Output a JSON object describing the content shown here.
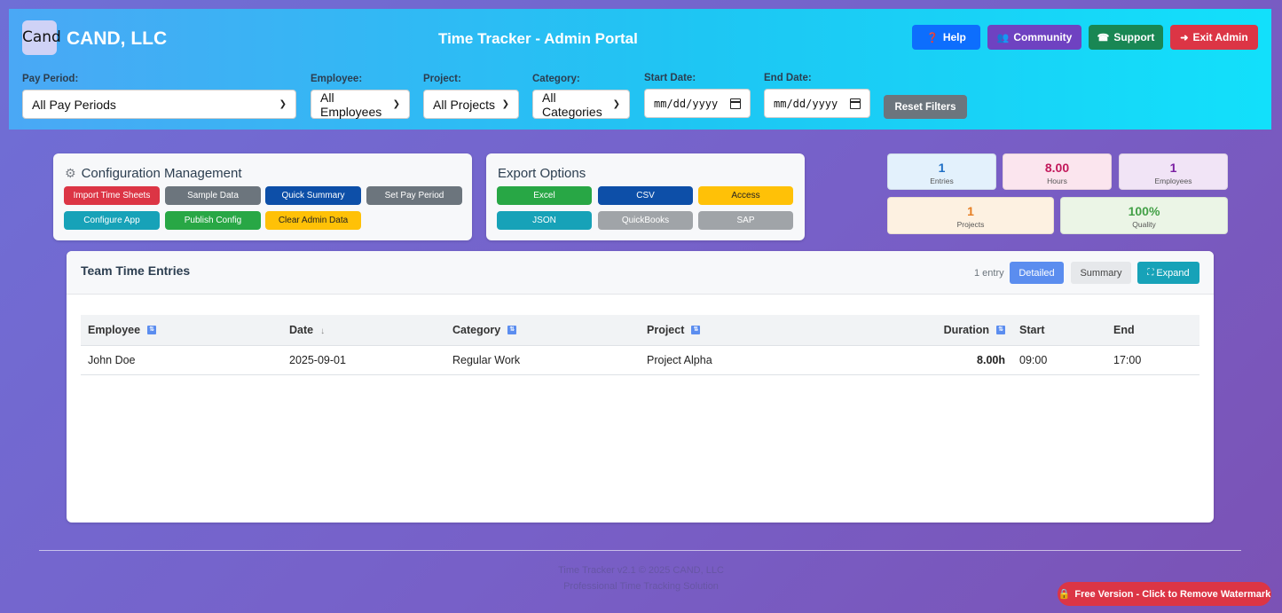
{
  "header": {
    "logo_text": "Cand",
    "company": "CAND, LLC",
    "title": "Time Tracker - Admin Portal",
    "buttons": {
      "help": "Help",
      "community": "Community",
      "support": "Support",
      "exit": "Exit Admin"
    }
  },
  "filters": {
    "pay_period": {
      "label": "Pay Period:",
      "value": "All Pay Periods"
    },
    "employee": {
      "label": "Employee:",
      "value": "All Employees"
    },
    "project": {
      "label": "Project:",
      "value": "All Projects"
    },
    "category": {
      "label": "Category:",
      "value": "All Categories"
    },
    "start_date": {
      "label": "Start Date:",
      "placeholder": "mm/dd/yyyy"
    },
    "end_date": {
      "label": "End Date:",
      "placeholder": "mm/dd/yyyy"
    },
    "reset": "Reset Filters"
  },
  "config": {
    "title": "Configuration Management",
    "buttons": [
      "Import Time Sheets",
      "Sample Data",
      "Quick Summary",
      "Set Pay Period",
      "Configure App",
      "Publish Config",
      "Clear Admin Data"
    ]
  },
  "export": {
    "title": "Export Options",
    "buttons": [
      "Excel",
      "CSV",
      "Access",
      "JSON",
      "QuickBooks",
      "SAP"
    ]
  },
  "stats": {
    "entries": {
      "value": "1",
      "label": "Entries",
      "color": "#1f6fc5"
    },
    "hours": {
      "value": "8.00",
      "label": "Hours",
      "color": "#c2185b"
    },
    "employees": {
      "value": "1",
      "label": "Employees",
      "color": "#7b1fa2"
    },
    "projects": {
      "value": "1",
      "label": "Projects",
      "color": "#e67e22"
    },
    "quality": {
      "value": "100%",
      "label": "Quality",
      "color": "#43a047"
    }
  },
  "table": {
    "title": "Team Time Entries",
    "count": "1 entry",
    "views": {
      "detailed": "Detailed",
      "summary": "Summary",
      "expand": "Expand"
    },
    "columns": [
      "Employee",
      "Date",
      "Category",
      "Project",
      "Duration",
      "Start",
      "End"
    ],
    "rows": [
      {
        "employee": "John Doe",
        "date": "2025-09-01",
        "category": "Regular Work",
        "project": "Project Alpha",
        "duration": "8.00h",
        "start": "09:00",
        "end": "17:00"
      }
    ]
  },
  "footer": {
    "line1": "Time Tracker v2.1 © 2025 CAND, LLC",
    "line2": "Professional Time Tracking Solution"
  },
  "watermark": "Free Version - Click to Remove Watermark"
}
